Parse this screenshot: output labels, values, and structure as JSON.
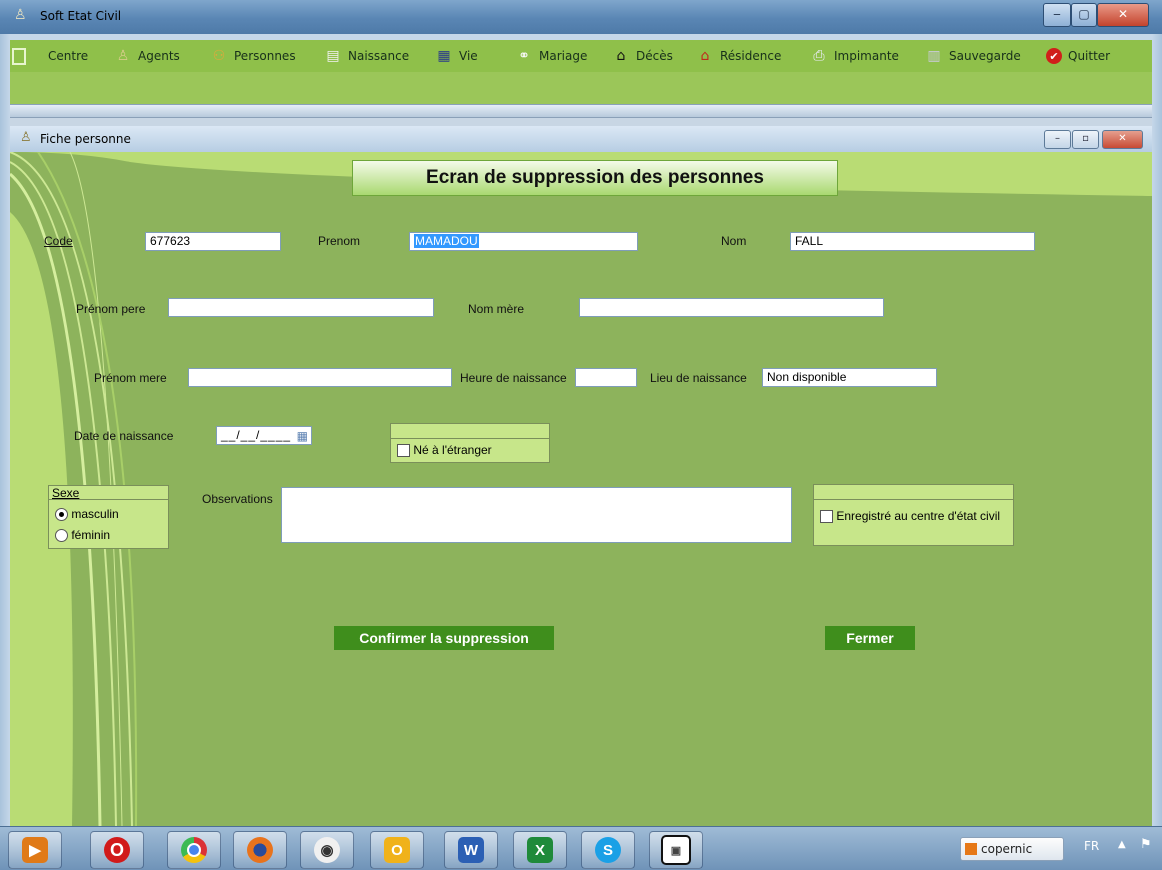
{
  "app": {
    "title": "Soft Etat Civil",
    "window_buttons": {
      "minimize": "‒",
      "maximize": "▢",
      "close": "✕"
    }
  },
  "menu": {
    "items": [
      {
        "label": "Centre",
        "icon": "centre-icon"
      },
      {
        "label": "Agents",
        "icon": "agent-icon"
      },
      {
        "label": "Personnes",
        "icon": "persons-icon"
      },
      {
        "label": "Naissance",
        "icon": "document-icon"
      },
      {
        "label": "Vie",
        "icon": "life-icon"
      },
      {
        "label": "Mariage",
        "icon": "couple-icon"
      },
      {
        "label": "Décès",
        "icon": "death-icon"
      },
      {
        "label": "Résidence",
        "icon": "house-icon"
      },
      {
        "label": "Impimante",
        "icon": "printer-icon"
      },
      {
        "label": "Sauvegarde",
        "icon": "save-icon"
      },
      {
        "label": "Quitter",
        "icon": "quit-icon"
      }
    ]
  },
  "child_window": {
    "title": "Fiche personne",
    "buttons": {
      "minimize": "–",
      "maximize": "▫",
      "close": "✕"
    }
  },
  "form": {
    "banner": "Ecran de suppression des personnes",
    "code": {
      "label": "Code",
      "value": "677623"
    },
    "prenom": {
      "label": "Prenom",
      "value": "MAMADOU"
    },
    "nom": {
      "label": "Nom",
      "value": "FALL"
    },
    "prenom_pere": {
      "label": "Prénom pere",
      "value": ""
    },
    "nom_mere": {
      "label": "Nom mère",
      "value": ""
    },
    "prenom_mere": {
      "label": "Prénom mere",
      "value": ""
    },
    "heure_naissance": {
      "label": "Heure de naissance",
      "value": ""
    },
    "lieu_naissance": {
      "label": "Lieu de naissance",
      "value": "Non disponible"
    },
    "date_naissance": {
      "label": "Date de naissance",
      "value": "__/__/____"
    },
    "ne_etranger": {
      "label": "Né à l'étranger",
      "checked": false
    },
    "sexe": {
      "label": "Sexe",
      "options": [
        "masculin",
        "féminin"
      ],
      "selected": "masculin"
    },
    "observations": {
      "label": "Observations",
      "value": ""
    },
    "enregistre": {
      "label": "Enregistré au centre d'état civil",
      "checked": false
    },
    "confirm_button": "Confirmer la suppression",
    "close_button": "Fermer"
  },
  "taskbar": {
    "apps": [
      "media-player-icon",
      "opera-icon",
      "chrome-icon",
      "firefox-icon",
      "app-icon",
      "outlook-icon",
      "word-icon",
      "excel-icon",
      "skype-icon",
      "window-icon"
    ],
    "tray_app": "copernic",
    "language": "FR"
  },
  "colors": {
    "accent_green": "#3f8e1c",
    "client_green": "#8db35c",
    "menu_green": "#8fc04a"
  }
}
